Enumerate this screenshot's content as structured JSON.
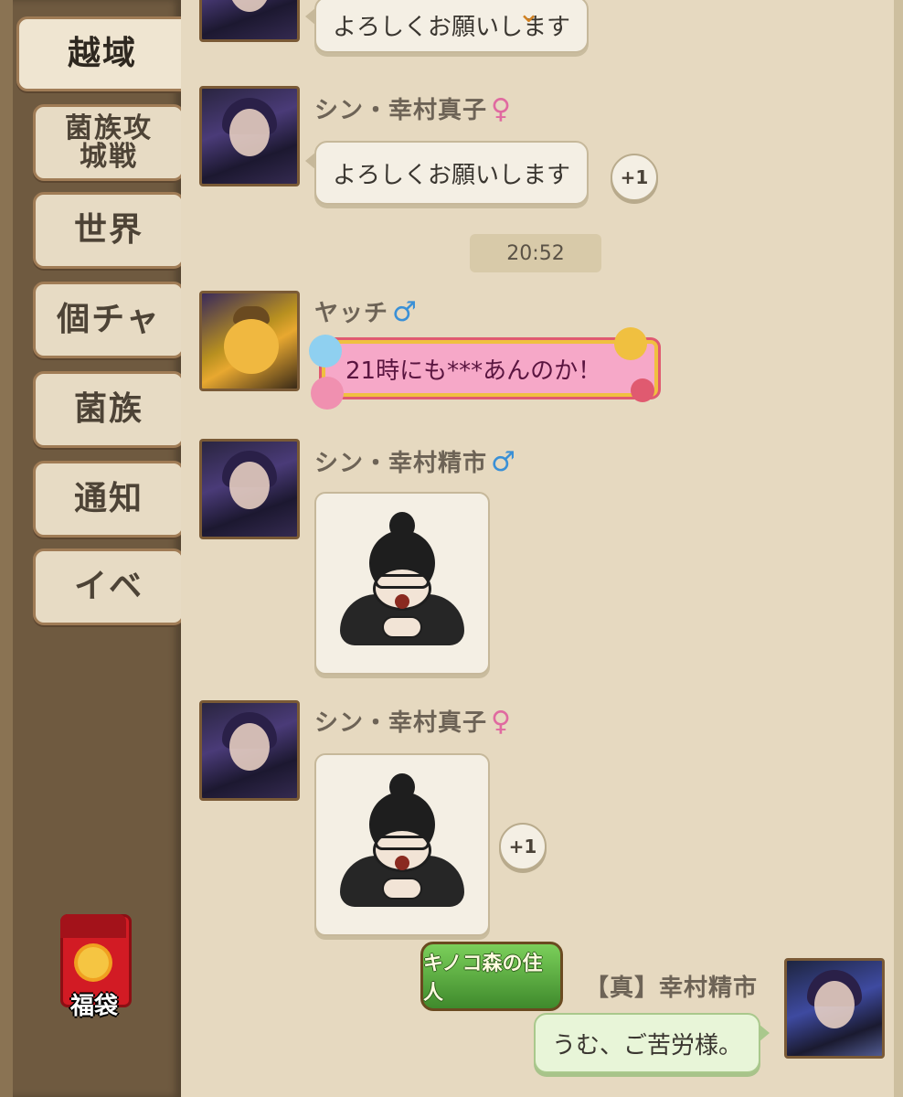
{
  "sidebar": {
    "tabs": [
      {
        "label": "越域",
        "active": true
      },
      {
        "label_lines": [
          "菌族攻",
          "城戦"
        ]
      },
      {
        "label": "世界"
      },
      {
        "label": "個チャ"
      },
      {
        "label": "菌族"
      },
      {
        "label": "通知"
      },
      {
        "label": "イベ"
      }
    ],
    "fukubukuro_label": "福袋"
  },
  "chat": {
    "top_partial_text": "よろしくお願いします",
    "timestamp": "20:52",
    "messages": [
      {
        "name": "シン・幸村真子",
        "gender": "♀",
        "text": "よろしくお願いします",
        "plus": "+1"
      },
      {
        "name": "ヤッチ",
        "gender": "♂",
        "text": "21時にも***あんのか！"
      },
      {
        "name": "シン・幸村精市",
        "gender": "♂",
        "sticker": "crying-chibi-sticker"
      },
      {
        "name": "シン・幸村真子",
        "gender": "♀",
        "sticker": "crying-chibi-sticker",
        "plus": "+1"
      },
      {
        "name": "【真】幸村精市",
        "title_badge": "キノコ森の住人",
        "text": "うむ、ご苦労様。"
      }
    ]
  },
  "colors": {
    "sidebar_bg": "#6f5a40",
    "chat_bg": "#e6d9c0",
    "female": "#e06aa0",
    "male": "#3a90d6",
    "special_bubble": "#f6a8c8",
    "own_bubble": "#e8f5d8"
  }
}
